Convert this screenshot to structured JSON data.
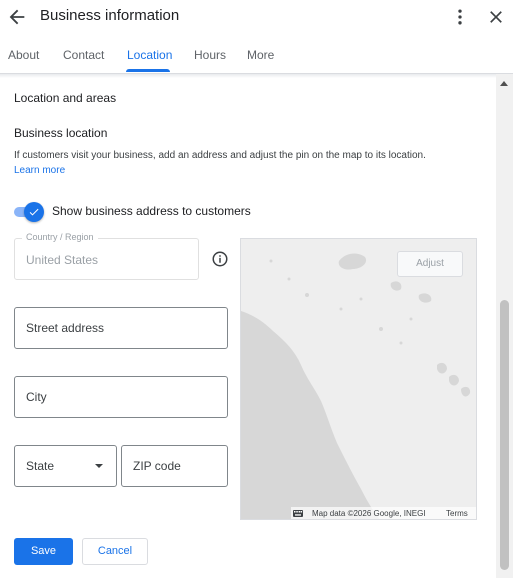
{
  "header": {
    "title": "Business information",
    "back_icon": "arrow-back-icon",
    "menu_icon": "more-vert-icon",
    "close_icon": "close-icon"
  },
  "tabs": [
    {
      "label": "About",
      "active": false
    },
    {
      "label": "Contact",
      "active": false
    },
    {
      "label": "Location",
      "active": true
    },
    {
      "label": "Hours",
      "active": false
    },
    {
      "label": "More",
      "active": false
    }
  ],
  "section": {
    "title": "Location and areas",
    "subtitle": "Business location",
    "help_text": "If customers visit your business, add an address and adjust the pin on the map to its location.",
    "learn_more": "Learn more"
  },
  "toggle": {
    "label": "Show business address to customers",
    "checked": true
  },
  "form": {
    "country_label": "Country / Region",
    "country_value": "United States",
    "street_placeholder": "Street address",
    "city_placeholder": "City",
    "state_placeholder": "State",
    "zip_placeholder": "ZIP code"
  },
  "map": {
    "adjust_label": "Adjust",
    "credit": "Map data ©2026 Google, INEGI",
    "terms": "Terms"
  },
  "actions": {
    "save_label": "Save",
    "cancel_label": "Cancel"
  },
  "colors": {
    "accent": "#1a73e8",
    "text": "#202124",
    "border": "#80868b"
  }
}
